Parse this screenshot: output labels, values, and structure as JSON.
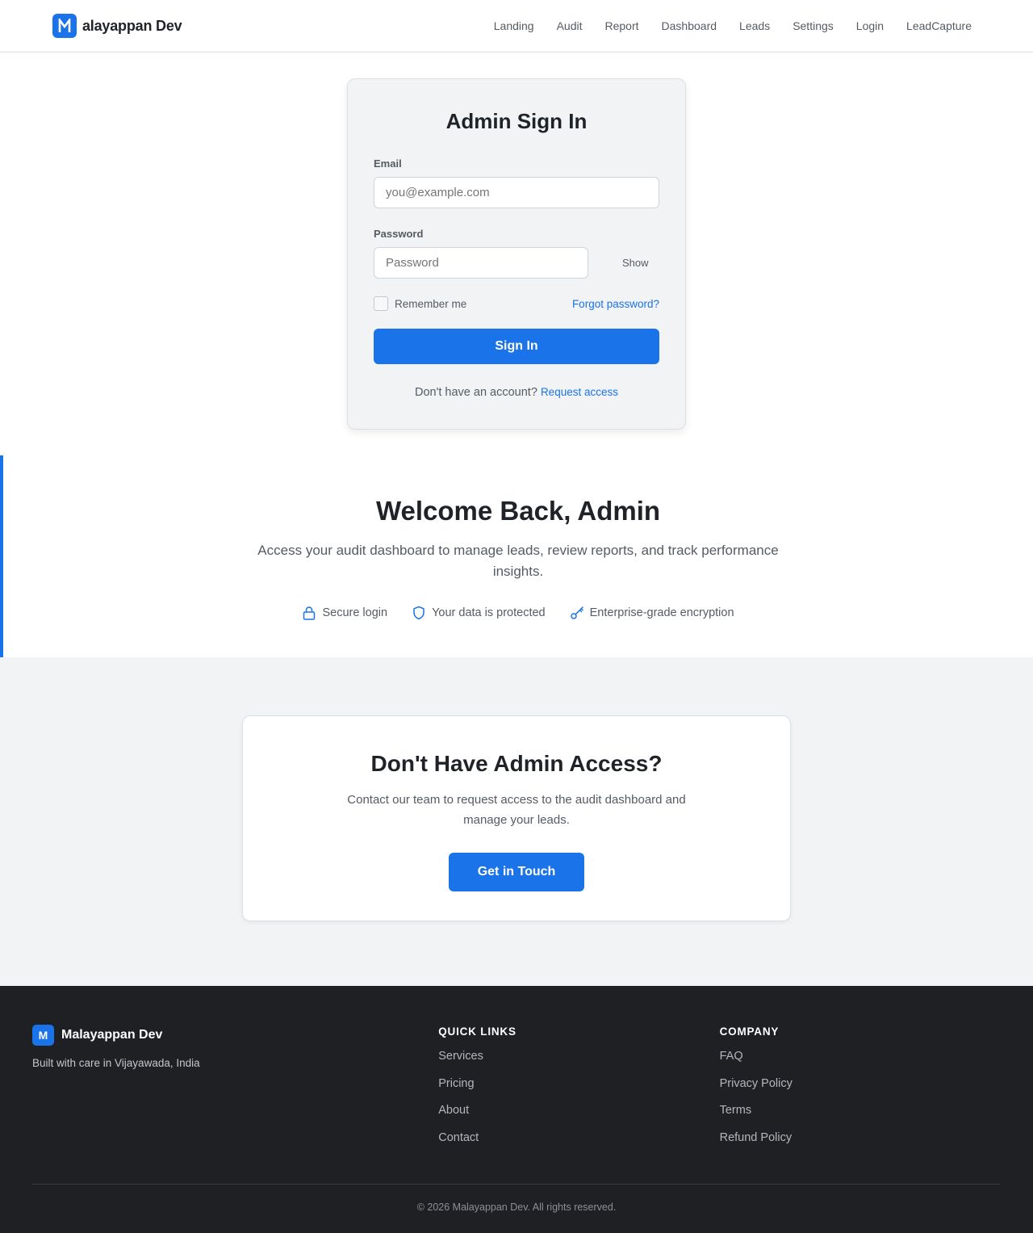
{
  "header": {
    "brand_name": "alayappan Dev",
    "logo_icon": "m-logo-icon",
    "nav": [
      {
        "label": "Landing"
      },
      {
        "label": "Audit"
      },
      {
        "label": "Report"
      },
      {
        "label": "Dashboard"
      },
      {
        "label": "Leads"
      },
      {
        "label": "Settings"
      },
      {
        "label": "Login"
      },
      {
        "label": "LeadCapture"
      }
    ]
  },
  "signin": {
    "title": "Admin Sign In",
    "email_label": "Email",
    "email_placeholder": "you@example.com",
    "email_value": "",
    "password_label": "Password",
    "password_placeholder": "Password",
    "password_value": "",
    "show_label": "Show",
    "remember_label": "Remember me",
    "remember_checked": false,
    "forgot_label": "Forgot password?",
    "submit_label": "Sign In",
    "no_account_text": "Don't have an account?",
    "request_access_label": "Request access"
  },
  "welcome": {
    "title": "Welcome Back, Admin",
    "subtitle": "Access your audit dashboard to manage leads, review reports, and track performance insights.",
    "features": [
      {
        "label": "Secure login",
        "icon": "lock-icon"
      },
      {
        "label": "Your data is protected",
        "icon": "shield-icon"
      },
      {
        "label": "Enterprise-grade encryption",
        "icon": "key-icon"
      }
    ]
  },
  "access": {
    "title": "Don't Have Admin Access?",
    "subtitle": "Contact our team to request access to the audit dashboard and manage your leads.",
    "button_label": "Get in Touch"
  },
  "footer": {
    "logo_letter": "M",
    "brand_name": "Malayappan Dev",
    "tagline": "Built with care in Vijayawada, India",
    "quick_links_heading": "QUICK LINKS",
    "quick_links": [
      "Services",
      "Pricing",
      "About",
      "Contact"
    ],
    "company_heading": "COMPANY",
    "company_links": [
      "FAQ",
      "Privacy Policy",
      "Terms",
      "Refund Policy"
    ],
    "copyright": "© 2026 Malayappan Dev. All rights reserved."
  },
  "colors": {
    "accent": "#1a73e8",
    "footer_bg": "#1f2024",
    "card_bg": "#f2f3f5"
  }
}
